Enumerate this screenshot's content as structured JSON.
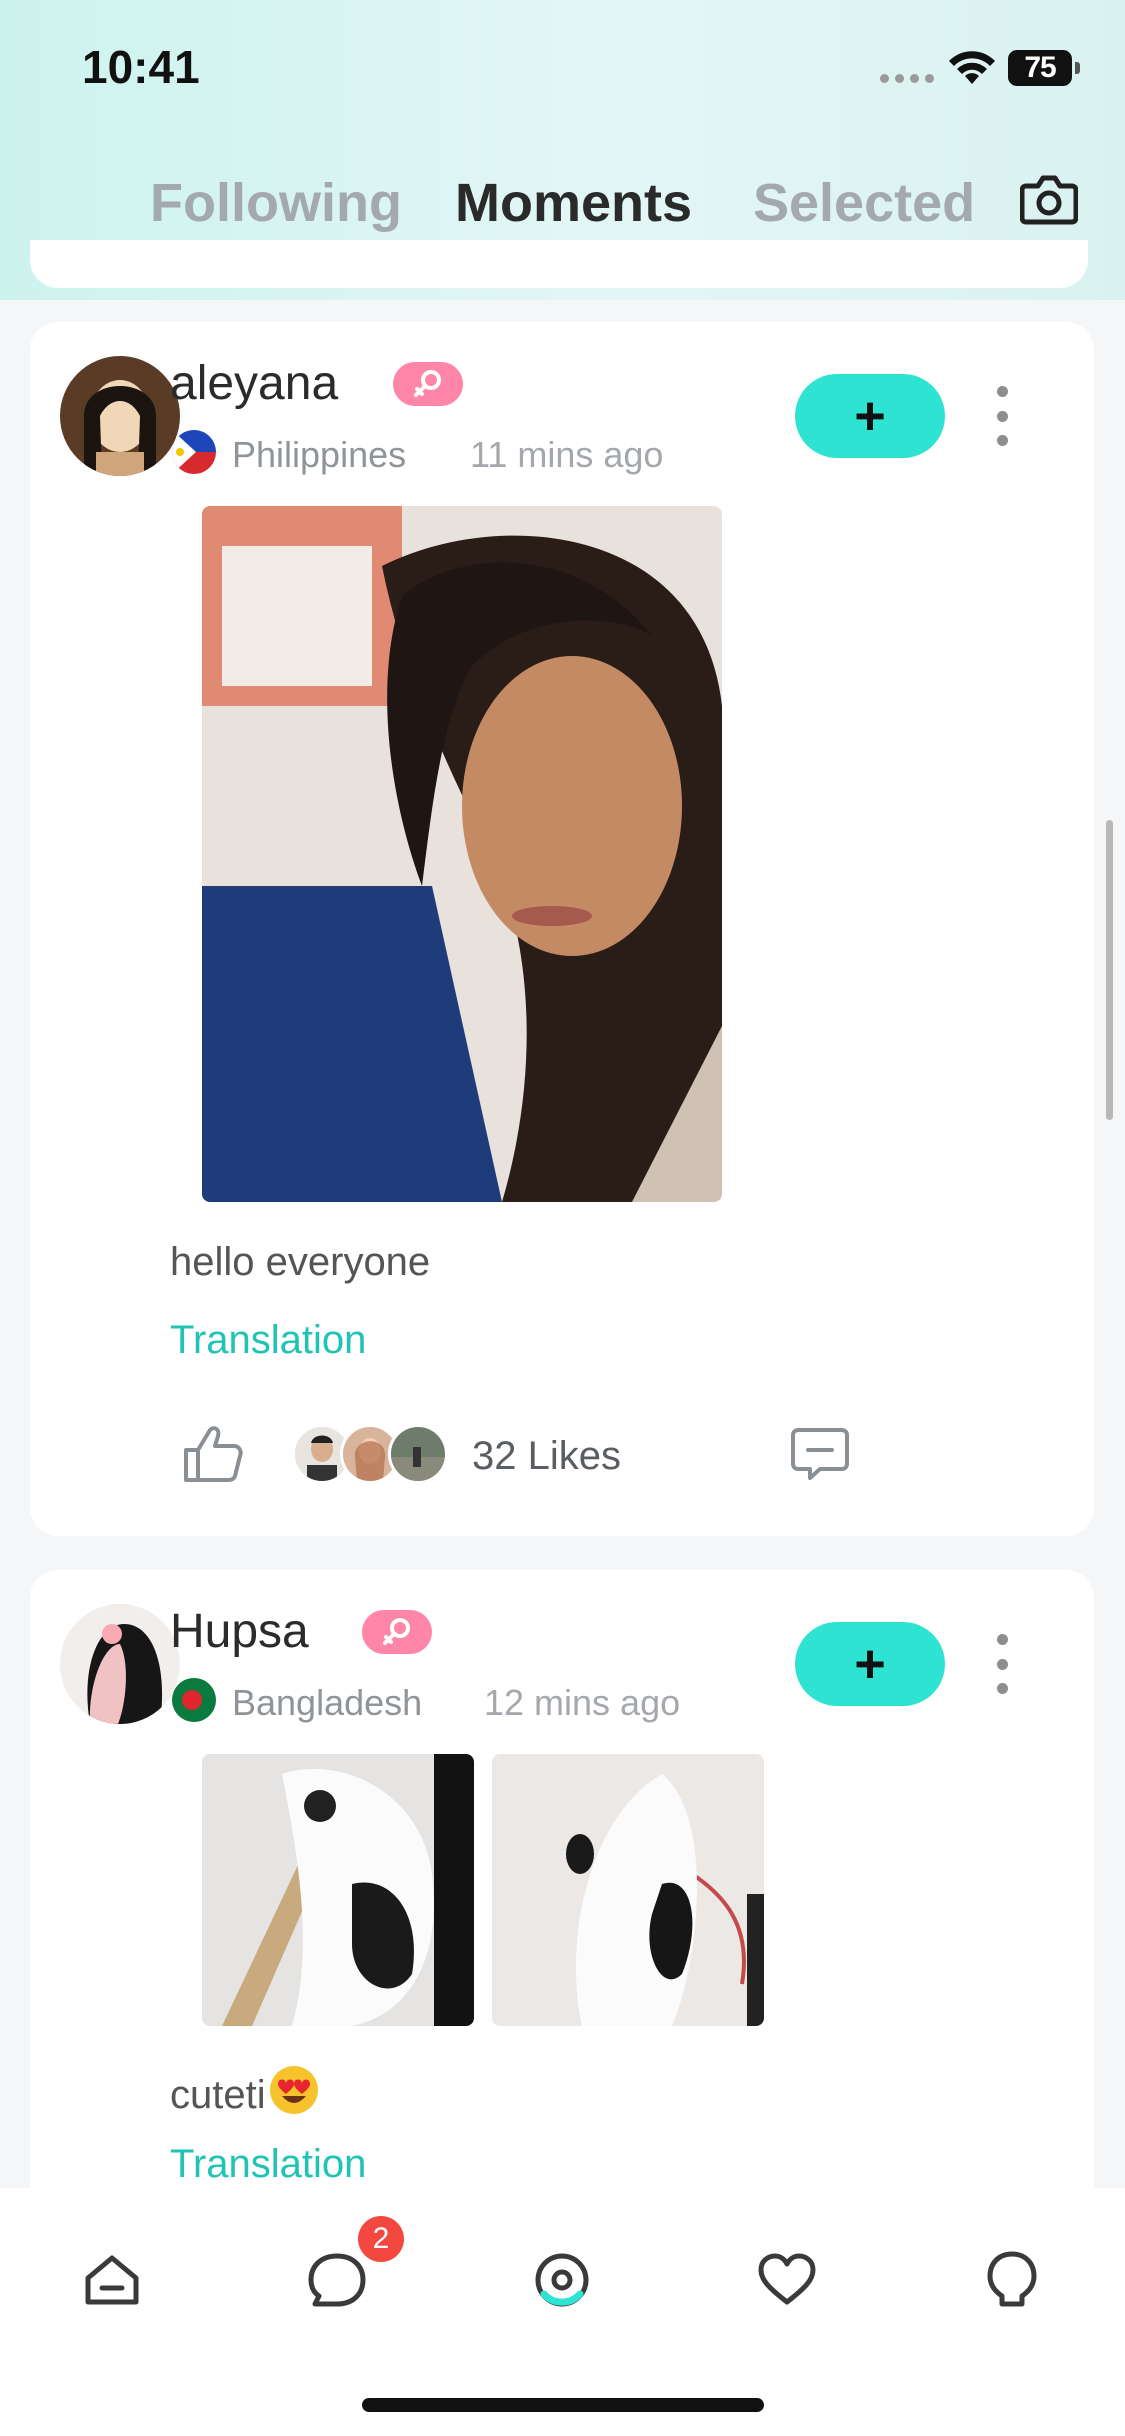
{
  "status_bar": {
    "time": "10:41",
    "battery": "75"
  },
  "tabs": [
    {
      "label": "Following"
    },
    {
      "label": "Moments"
    },
    {
      "label": "Selected"
    }
  ],
  "posts": [
    {
      "username": "aleyana",
      "country": "Philippines",
      "time_ago": "11 mins ago",
      "text": "hello everyone",
      "translation_label": "Translation",
      "likes": "32 Likes",
      "follow_label": "+"
    },
    {
      "username": "Hupsa",
      "country": "Bangladesh",
      "time_ago": "12 mins ago",
      "text": "cuteti",
      "translation_label": "Translation",
      "follow_label": "+"
    }
  ],
  "bottom_nav": {
    "messages_badge": "2"
  },
  "colors": {
    "accent": "#2fe3d3",
    "link": "#1fc4b5",
    "gender_badge": "#ff85a9",
    "badge": "#f2483f"
  }
}
